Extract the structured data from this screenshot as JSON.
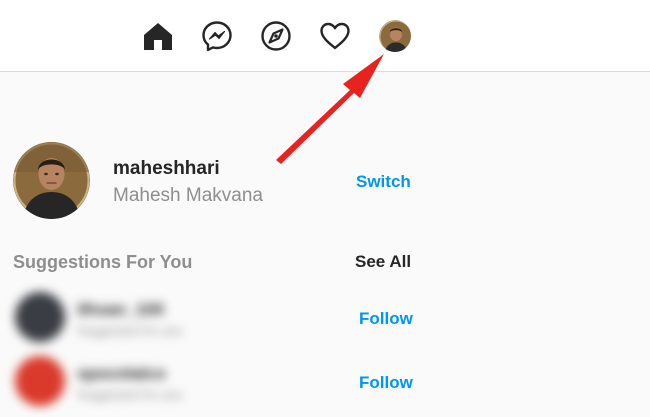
{
  "nav": {
    "icons": [
      "home-icon",
      "messenger-icon",
      "explore-compass-icon",
      "heart-activity-icon",
      "profile-avatar"
    ]
  },
  "profile": {
    "username": "maheshhari",
    "full_name": "Mahesh Makvana",
    "switch_label": "Switch"
  },
  "suggestions": {
    "title": "Suggestions For You",
    "see_all_label": "See All",
    "items": [
      {
        "follow_label": "Follow",
        "avatar_color": "#3a3d44",
        "name_blurred": "ilhsan_100",
        "sub_blurred": "Suggested for you"
      },
      {
        "follow_label": "Follow",
        "avatar_color": "#d93a2b",
        "name_blurred": "spocnlalco",
        "sub_blurred": "Suggested for you"
      }
    ]
  },
  "colors": {
    "accent_blue": "#0095f6",
    "arrow_red": "#e8231f",
    "text_dark": "#262626",
    "text_gray": "#8e8e8e",
    "background": "#fafafa",
    "border": "#dbdbdb"
  }
}
